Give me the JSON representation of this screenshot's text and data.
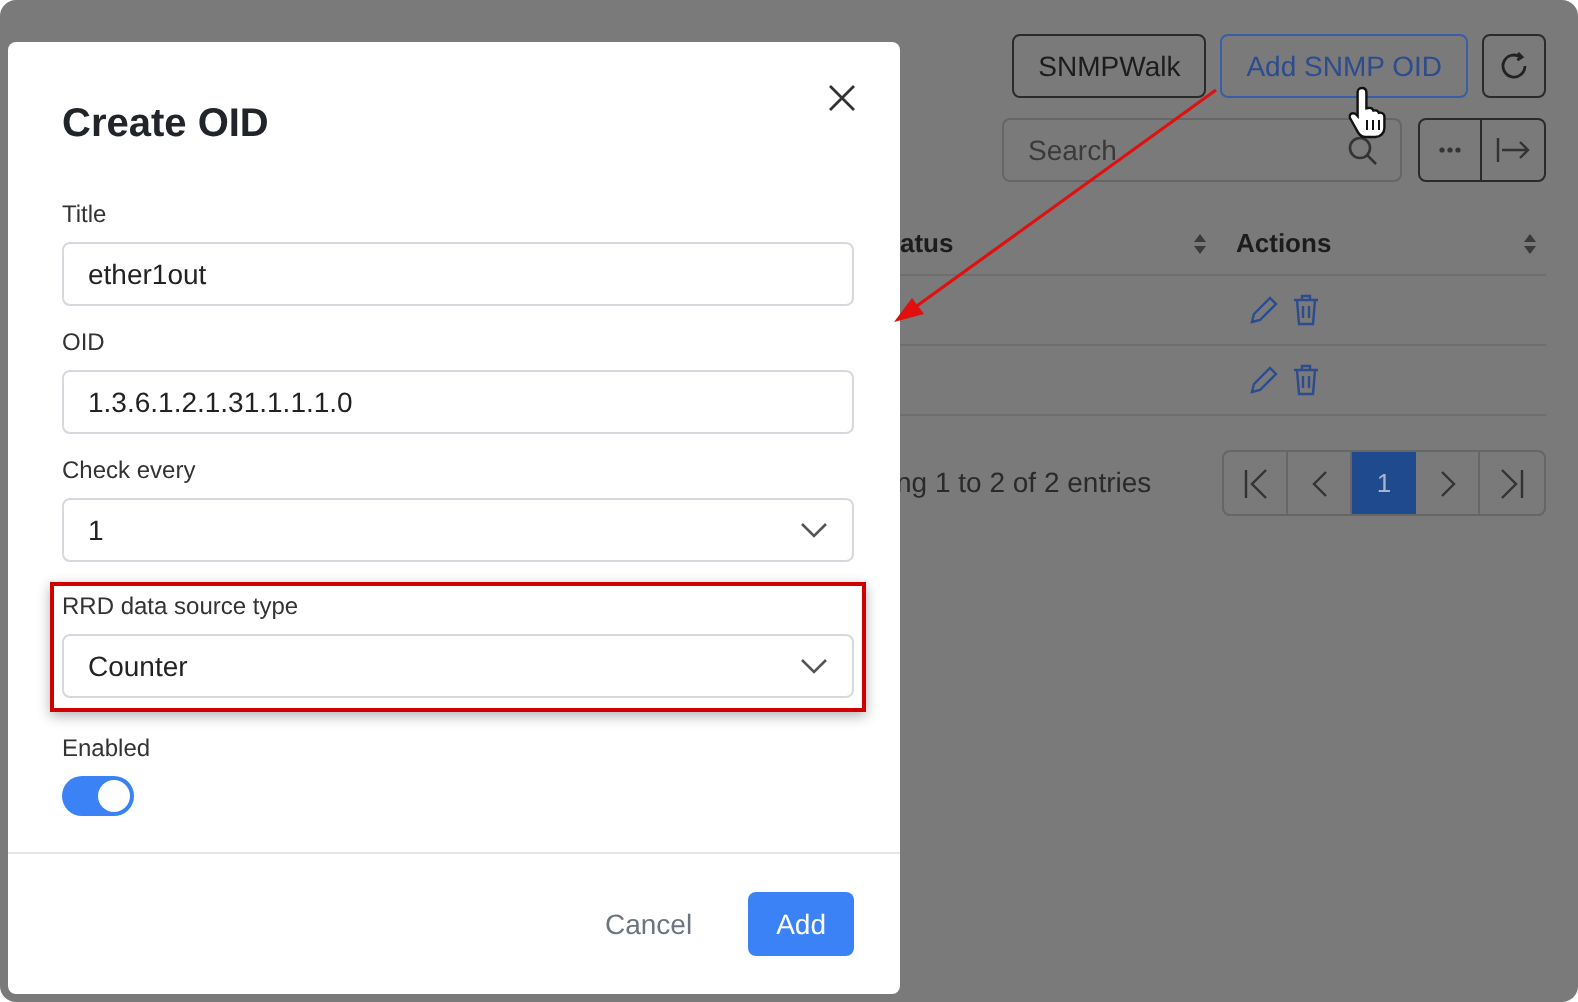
{
  "background": {
    "buttons": [
      {
        "label": "SNMPWalk",
        "kind": "plain"
      },
      {
        "label": "Add SNMP OID",
        "kind": "primary"
      }
    ],
    "search": {
      "placeholder": "Search"
    },
    "table": {
      "columns": [
        "atus",
        "Actions"
      ],
      "rows": [
        {
          "kind": "actions"
        },
        {
          "kind": "actions"
        }
      ]
    },
    "entries": "ng 1 to 2 of 2 entries",
    "pages": [
      {
        "label": "1",
        "selected": true
      }
    ]
  },
  "modal": {
    "title": "Create OID",
    "fields": [
      {
        "kind": "text",
        "label": "Title",
        "value": "ether1out",
        "highlighted": false
      },
      {
        "kind": "text",
        "label": "OID",
        "value": "1.3.6.1.2.1.31.1.1.1.0",
        "highlighted": false
      },
      {
        "kind": "select",
        "label": "Check every",
        "value": "1",
        "highlighted": false
      },
      {
        "kind": "select",
        "label": "RRD data source type",
        "value": "Counter",
        "highlighted": true
      },
      {
        "kind": "toggle",
        "label": "Enabled",
        "on": true,
        "highlighted": false
      }
    ],
    "buttons": [
      {
        "label": "Cancel",
        "kind": "plain"
      },
      {
        "label": "Add",
        "kind": "primary"
      }
    ]
  }
}
